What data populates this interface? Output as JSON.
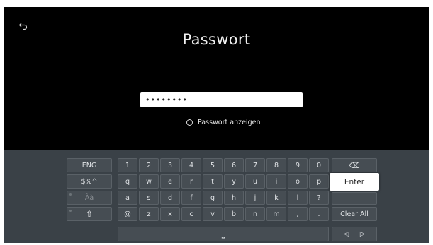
{
  "title": "Passwort",
  "password": {
    "masked_value": "••••••••"
  },
  "show_password_label": "Passwort anzeigen",
  "keyboard": {
    "side_keys": [
      "ENG",
      "$%^",
      "Àà",
      "⇧"
    ],
    "rows": [
      [
        "1",
        "2",
        "3",
        "4",
        "5",
        "6",
        "7",
        "8",
        "9",
        "0"
      ],
      [
        "q",
        "w",
        "e",
        "r",
        "t",
        "y",
        "u",
        "i",
        "o",
        "p"
      ],
      [
        "a",
        "s",
        "d",
        "f",
        "g",
        "h",
        "j",
        "k",
        "l",
        "?"
      ],
      [
        "@",
        "z",
        "x",
        "c",
        "v",
        "b",
        "n",
        "m",
        ",",
        "."
      ]
    ],
    "backspace_glyph": "⌫",
    "enter_label": "Enter",
    "clear_all_label": "Clear All",
    "space_glyph": "⎵",
    "left_arrow_glyph": "◁",
    "right_arrow_glyph": "▷"
  }
}
